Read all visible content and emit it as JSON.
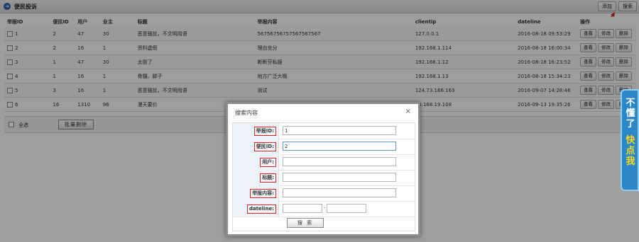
{
  "page": {
    "title": "便民投诉",
    "add_label": "添加",
    "search_label": "搜索"
  },
  "table": {
    "headers": [
      "举报ID",
      "便民ID",
      "用户",
      "业主",
      "标题",
      "举报内容",
      "clientip",
      "dateline",
      "操作"
    ],
    "rows": [
      {
        "id": "1",
        "bm": "2",
        "user": "47",
        "owner": "30",
        "title": "恶意骚扰，不文明用语",
        "content": "56756756757567567567",
        "ip": "127.0.0.1",
        "date": "2016-08-18 09:53:29"
      },
      {
        "id": "2",
        "bm": "2",
        "user": "16",
        "owner": "1",
        "title": "资料虚假",
        "content": "理由充分",
        "ip": "192.168.1.114",
        "date": "2016-08-18 16:00:34"
      },
      {
        "id": "3",
        "bm": "1",
        "user": "47",
        "owner": "30",
        "title": "太刚了",
        "content": "断断芬私服",
        "ip": "192.168.1.12",
        "date": "2016-08-18 16:23:52"
      },
      {
        "id": "4",
        "bm": "1",
        "user": "16",
        "owner": "1",
        "title": "骨髓，脚子",
        "content": "地方广泛大概",
        "ip": "192.168.1.13",
        "date": "2016-08-18 15:34:23"
      },
      {
        "id": "5",
        "bm": "3",
        "user": "16",
        "owner": "1",
        "title": "恶意骚扰，不文明用语",
        "content": "测试",
        "ip": "124.73.166.163",
        "date": "2016-09-07 14:26:46"
      },
      {
        "id": "6",
        "bm": "16",
        "user": "1310",
        "owner": "96",
        "title": "漫天要价",
        "content": "",
        "ip": "60.168.19.108",
        "date": "2016-09-13 19:35:26"
      }
    ],
    "actions": {
      "view": "查看",
      "edit": "修改",
      "delete": "删除"
    }
  },
  "footer": {
    "select_all": "全选",
    "batch_delete": "批量删除"
  },
  "modal": {
    "title": "搜索内容",
    "close": "×",
    "fields": [
      {
        "label": "举报ID:",
        "value": "1"
      },
      {
        "label": "便民ID:",
        "value": "2"
      },
      {
        "label": "用户:",
        "value": ""
      },
      {
        "label": "标题:",
        "value": ""
      },
      {
        "label": "举报内容:",
        "value": ""
      },
      {
        "label": "dateline:",
        "value_from": "",
        "value_to": ""
      }
    ],
    "range_sep": "-",
    "submit": "搜 索"
  },
  "side_banner": {
    "line1": "不懂了",
    "line2": "快点我"
  },
  "colors": {
    "accent": "#1f63b4",
    "highlight": "#e02020",
    "banner": "#2b87c8"
  }
}
